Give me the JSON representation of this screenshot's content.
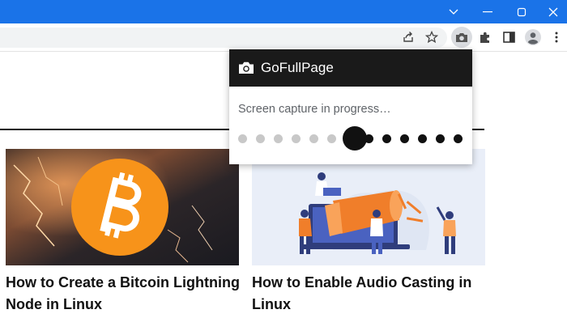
{
  "browser": {
    "accent": "#1a73e8",
    "window_controls": [
      "chevron-down-icon",
      "minimize-icon",
      "restore-icon",
      "close-icon"
    ],
    "toolbar_icons": [
      "share-icon",
      "star-icon",
      "camera-icon",
      "extensions-icon",
      "side-panel-icon",
      "profile-icon",
      "more-icon"
    ]
  },
  "cards": [
    {
      "title": "How to Create a Bitcoin Lightning Node in Linux",
      "image": "bitcoin-lightning-image"
    },
    {
      "title": "How to Enable Audio Casting in Linux",
      "image": "audio-casting-illustration"
    }
  ],
  "popup": {
    "title": "GoFullPage",
    "message": "Screen capture in progress…",
    "header_color": "#1a1a1a",
    "progress": {
      "total_steps": 13,
      "current_step": 7
    }
  }
}
